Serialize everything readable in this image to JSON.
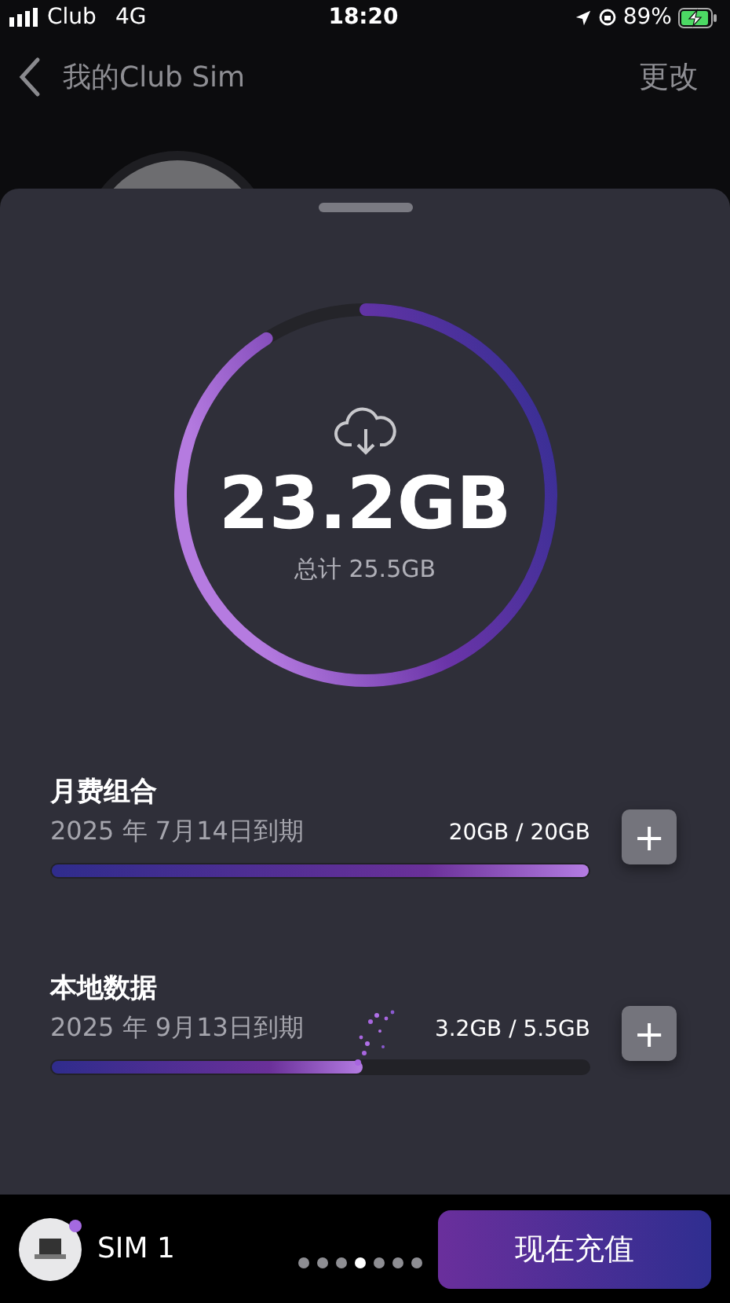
{
  "status_bar": {
    "carrier": "Club",
    "network": "4G",
    "time": "18:20",
    "battery": "89%"
  },
  "nav": {
    "title": "我的Club Sim",
    "action": "更改"
  },
  "usage": {
    "remaining": "23.2GB",
    "total": "总计 25.5GB"
  },
  "plans": [
    {
      "name": "月费组合",
      "expiry": "2025 年 7月14日到期",
      "amount": "20GB / 20GB",
      "level": 1.0
    },
    {
      "name": "本地数据",
      "expiry": "2025 年 9月13日到期",
      "amount": "3.2GB / 5.5GB",
      "level": 0.58
    }
  ],
  "add_button": "+",
  "bottom": {
    "sim": "SIM 1",
    "recharge": "现在充值"
  },
  "page_dots": [
    {
      "selected": false
    },
    {
      "selected": false
    },
    {
      "selected": false
    },
    {
      "selected": true
    },
    {
      "selected": false
    },
    {
      "selected": false
    },
    {
      "selected": false
    }
  ]
}
